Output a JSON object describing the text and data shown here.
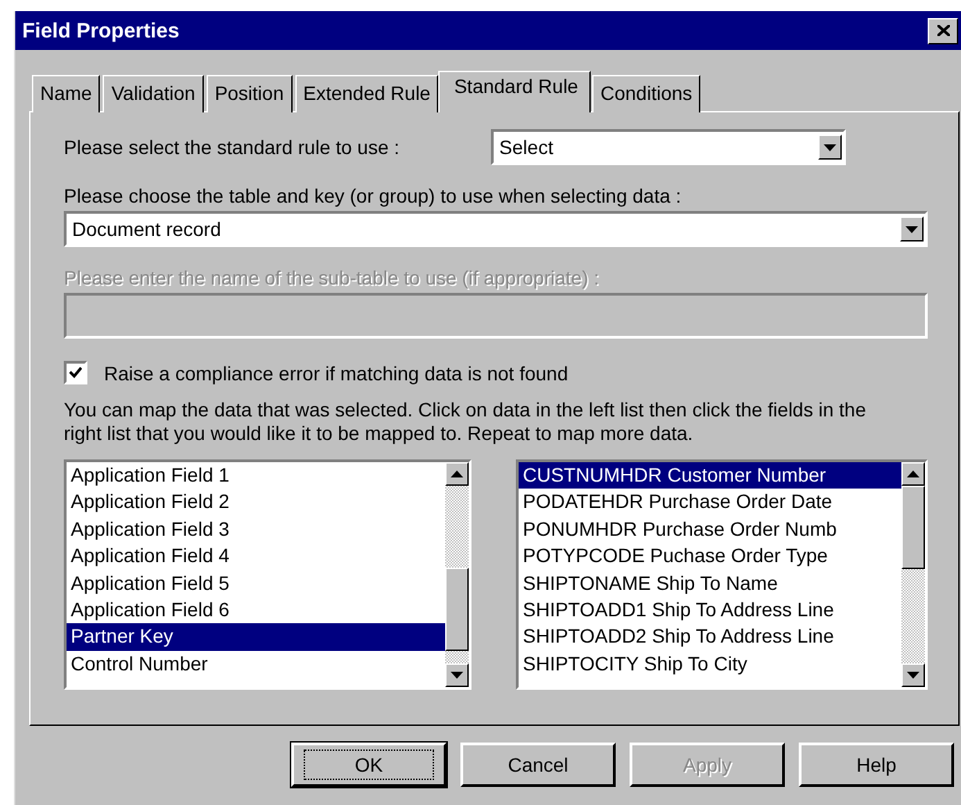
{
  "window": {
    "title": "Field Properties"
  },
  "tabs": [
    {
      "label": "Name",
      "selected": false
    },
    {
      "label": "Validation",
      "selected": false
    },
    {
      "label": "Position",
      "selected": false
    },
    {
      "label": "Extended Rule",
      "selected": false
    },
    {
      "label": "Standard Rule",
      "selected": true
    },
    {
      "label": "Conditions",
      "selected": false
    }
  ],
  "standard_rule": {
    "label": "Please select the standard rule to use :",
    "value": "Select"
  },
  "table_key": {
    "label": "Please choose the table and key (or group) to use when selecting data :",
    "value": "Document record"
  },
  "sub_table": {
    "label": "Please enter the name of the sub-table to use (if appropriate) :",
    "disabled": true
  },
  "compliance_checkbox": {
    "label": "Raise a compliance error if matching data is not found",
    "checked": true
  },
  "instructions": "You can map the data that was selected. Click on data in the left list then click the fields in the right list that you would like it to be mapped to. Repeat to map more data.",
  "source_list": {
    "items": [
      {
        "label": "Application Field 1",
        "selected": false
      },
      {
        "label": "Application Field 2",
        "selected": false
      },
      {
        "label": "Application Field 3",
        "selected": false
      },
      {
        "label": "Application Field 4",
        "selected": false
      },
      {
        "label": "Application Field 5",
        "selected": false
      },
      {
        "label": "Application Field 6",
        "selected": false
      },
      {
        "label": "Partner Key",
        "selected": true
      },
      {
        "label": "Control Number",
        "selected": false
      }
    ]
  },
  "target_list": {
    "items": [
      {
        "label": "CUSTNUMHDR Customer Number",
        "selected": true
      },
      {
        "label": "PODATEHDR Purchase Order Date",
        "selected": false
      },
      {
        "label": "PONUMHDR Purchase Order Numb",
        "selected": false
      },
      {
        "label": "POTYPCODE Puchase Order Type",
        "selected": false
      },
      {
        "label": "SHIPTONAME Ship To Name",
        "selected": false
      },
      {
        "label": "SHIPTOADD1 Ship To Address Line",
        "selected": false
      },
      {
        "label": "SHIPTOADD2 Ship To Address Line",
        "selected": false
      },
      {
        "label": "SHIPTOCITY Ship To City",
        "selected": false
      }
    ]
  },
  "buttons": [
    {
      "label": "OK",
      "default": true,
      "disabled": false
    },
    {
      "label": "Cancel",
      "default": false,
      "disabled": false
    },
    {
      "label": "Apply",
      "default": false,
      "disabled": true
    },
    {
      "label": "Help",
      "default": false,
      "disabled": false
    }
  ]
}
